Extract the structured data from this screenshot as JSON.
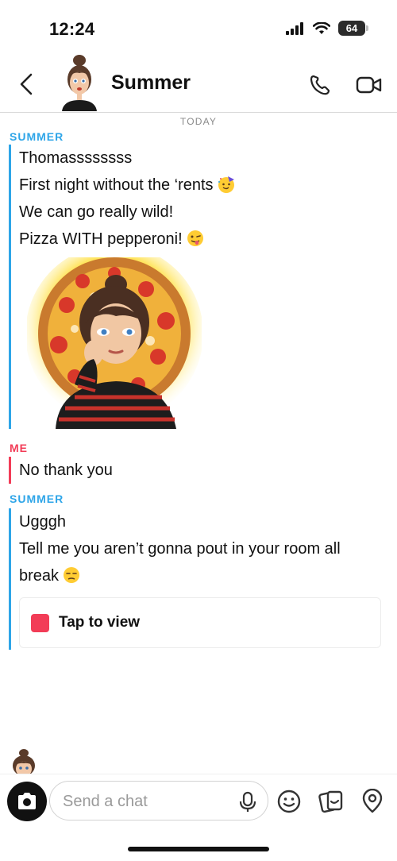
{
  "status_bar": {
    "time": "12:24",
    "battery": "64"
  },
  "header": {
    "contact_name": "Summer",
    "icons": [
      "back-chevron-icon",
      "bitmoji-avatar",
      "phone-icon",
      "video-camera-icon"
    ]
  },
  "chat": {
    "day_label": "TODAY",
    "groups": [
      {
        "sender": "SUMMER",
        "lines": [
          "Thomassssssss",
          "First night without the ‘rents",
          "We can go really wild!",
          "Pizza WITH pepperoni!"
        ],
        "emojis": [
          "partying-face",
          "winking-face-with-tongue"
        ],
        "sticker": "bitmoji-pizza-sticker"
      },
      {
        "sender": "ME",
        "lines": [
          "No thank you"
        ]
      },
      {
        "sender": "SUMMER",
        "lines": [
          "Ugggh",
          "Tell me you aren’t gonna pout in your room all",
          "break"
        ],
        "emojis": [
          "unamused-face"
        ],
        "snap": {
          "label": "Tap to view"
        }
      }
    ]
  },
  "composer": {
    "placeholder": "Send a chat",
    "icons": [
      "camera-icon",
      "microphone-icon",
      "smiley-icon",
      "sticker-icon",
      "location-pin-icon"
    ]
  },
  "colors": {
    "summer_accent": "#2ea5e8",
    "me_accent": "#f23c57",
    "snap_red": "#f23c57"
  }
}
